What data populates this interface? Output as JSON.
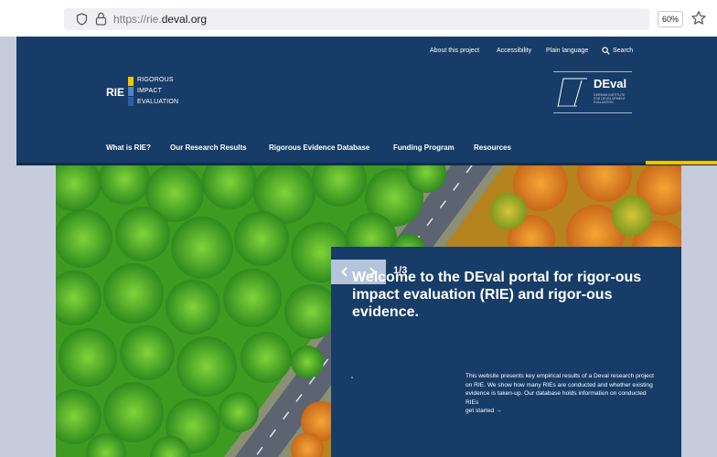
{
  "browser": {
    "url_prefix": "https://rie.",
    "url_domain": "deval.org",
    "zoom": "60%"
  },
  "header": {
    "utility_links": [
      "About this project",
      "Accessibility",
      "Plain language",
      "Search"
    ],
    "logo": {
      "mark": "RIE",
      "lines": [
        "RIGOROUS",
        "IMPACT",
        "EVALUATION"
      ],
      "bar_colors": [
        "#f3c400",
        "#4f86c6",
        "#2a5ea8"
      ]
    },
    "partner_logo": {
      "name": "DEval",
      "tagline": "GERMAN INSTITUTE FOR DEVELOPMENT EVALUATION"
    },
    "nav": [
      "What is RIE?",
      "Our Research Results",
      "Rigorous Evidence Database",
      "Funding Program",
      "Resources"
    ]
  },
  "hero": {
    "counter": "1/3",
    "headline": "Welcome to the DEval portal for rigor-ous impact evaluation (RIE) and rigor-ous evidence.",
    "body": "This website presents key empirical results of a Deval research project on RIE. We show how many RIEs are conducted and whether existing evidence is taken-up. Our database holds information on conducted RIEs",
    "cta": "get started →"
  },
  "colors": {
    "navy": "#173c67",
    "accent_yellow": "#f3c400",
    "page_bg": "#c6ccdc"
  },
  "icons": [
    "shield-icon",
    "lock-icon",
    "star-icon",
    "search-icon",
    "chevron-left-icon",
    "chevron-right-icon"
  ]
}
